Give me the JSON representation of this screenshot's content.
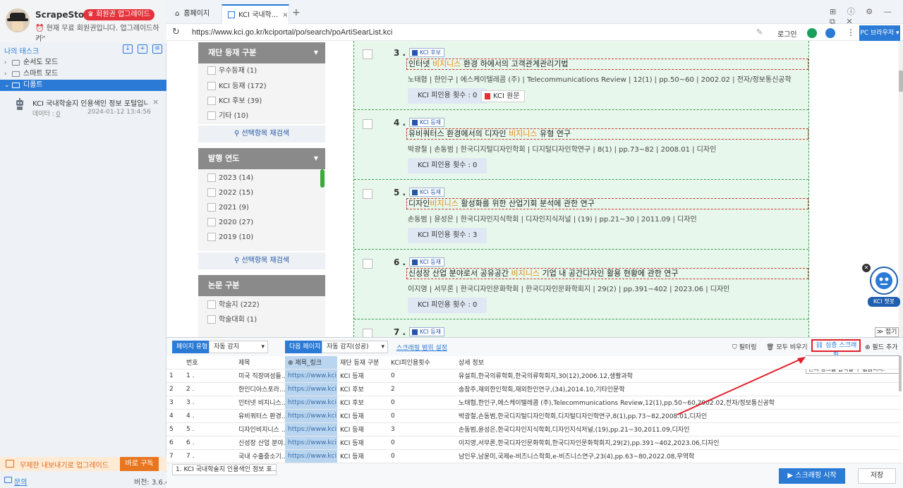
{
  "sidebar": {
    "app_name": "ScrapeStorm",
    "upgrade_badge": "회원권 업그레이드",
    "member_text": "현재 무료 회원권입니다. 업그레이드하기",
    "member_more": ">>",
    "my_tasks": "나의 태스크",
    "tree": [
      "순서도 모드",
      "스마트 모드",
      "디폴트"
    ],
    "task": {
      "title": "KCI 국내학술지 인용색인 정보 포털입니다.-...",
      "data_label": "데이터 :",
      "data_count": "0",
      "date": "2024-01-12 13:4:56"
    },
    "promo_text": "무제한 내보내기로 업그레이드",
    "promo_btn": "바로 구독",
    "inquiry": "문의",
    "version": "버전: 3.6.4"
  },
  "browser": {
    "tabs": [
      "홈페이지",
      "KCI 국내학..."
    ],
    "url": "https://www.kci.go.kr/kciportal/po/search/poArtiSearList.kci",
    "login": "로그인",
    "pc_browser": "PC 브라우저"
  },
  "facets": {
    "registration": {
      "title": "재단 등재 구분",
      "items": [
        {
          "label": "우수등재",
          "count": "(1)"
        },
        {
          "label": "KCI 등재",
          "count": "(172)"
        },
        {
          "label": "KCI 후보",
          "count": "(39)"
        },
        {
          "label": "기타",
          "count": "(10)"
        }
      ]
    },
    "year": {
      "title": "발행 연도",
      "items": [
        {
          "label": "2023",
          "count": "(14)"
        },
        {
          "label": "2022",
          "count": "(15)"
        },
        {
          "label": "2021",
          "count": "(9)"
        },
        {
          "label": "2020",
          "count": "(27)"
        },
        {
          "label": "2019",
          "count": "(10)"
        }
      ]
    },
    "paper_type": {
      "title": "논문 구분",
      "items": [
        {
          "label": "학술지",
          "count": "(222)"
        },
        {
          "label": "학술대회",
          "count": "(1)"
        }
      ]
    },
    "research_btn": "선택항목 재검색"
  },
  "results": [
    {
      "num": "3 .",
      "badge": "KCI 후보",
      "title_pre": "인터넷 ",
      "title_hl": "비지니스",
      "title_post": " 환경 하에서의 고객관계관리기법",
      "meta": "노태협 | 한인구 | 에스케이텔레콤 (주) | Telecommunications Review | 12(1) | pp.50~60 | 2002.02 | 전자/정보통신공학",
      "cite": "KCI 피인용 횟수 : 0",
      "orig": "KCI 원문"
    },
    {
      "num": "4 .",
      "badge": "KCI 등재",
      "title_pre": "유비쿼터스 환경에서의 디자인 ",
      "title_hl": "비지니스",
      "title_post": " 유형 연구",
      "meta": "박광철 | 손동범 | 한국디지털디자인학회 | 디지털디자인학연구 | 8(1) | pp.73~82 | 2008.01 | 디자인",
      "cite": "KCI 피인용 횟수 : 0",
      "orig": ""
    },
    {
      "num": "5 .",
      "badge": "KCI 등재",
      "title_pre": "디자인",
      "title_hl": "비지니스",
      "title_post": " 활성화를 위한 산업기회 분석에 관한 연구",
      "meta": "손동범 | 윤성은 | 한국디자인지식학회 | 디자인지식저널 | (19) | pp.21~30 | 2011.09 | 디자인",
      "cite": "KCI 피인용 횟수 : 3",
      "orig": ""
    },
    {
      "num": "6 .",
      "badge": "KCI 등재",
      "title_pre": "신성장 산업 분야로서 공유공간 ",
      "title_hl": "비지니스",
      "title_post": " 기업 내 공간디자인 활용 현황에 관한 연구",
      "meta": "이지영 | 서무론 | 한국디자인문화학회 | 한국디자인문화학회지 | 29(2) | pp.391~402 | 2023.06 | 디자인",
      "cite": "KCI 피인용 횟수 : 0",
      "orig": ""
    },
    {
      "num": "7 .",
      "badge": "KCI 등재",
      "title_pre": "",
      "title_hl": "",
      "title_post": "",
      "meta": "",
      "cite": "",
      "orig": ""
    }
  ],
  "chatbot_label": "KCI 챗봇",
  "collapse": "≫ 접기",
  "panel": {
    "page_type_label": "페이지 유형",
    "page_type_value": "자동 감지",
    "next_page_label": "다음 페이지",
    "next_page_value": "자동 감지(성공)",
    "scrape_range": "스크래핑 범위 설정",
    "filter": "필터링",
    "clear_all": "모두 비우기",
    "deep_scrape": "심층 스크래핑",
    "add_field": "필드 추가",
    "tooltip": "디폴트로 첫 번째 링크를 엽니다. 표 안의 링크를 클릭할 수 없습니다.",
    "columns": [
      "",
      "번호",
      "제목",
      "제목_링크",
      "재단 등재 구분",
      "KCI피인용횟수",
      "상세 정보"
    ],
    "rows": [
      [
        "1",
        "1 .",
        "미국 직장여성들...",
        "https://www.kci....",
        "KCI 등재",
        "0",
        "유설희,한국의류학회,한국의류학회지,30(12),2006.12,생활과학"
      ],
      [
        "2",
        "2 .",
        "한인디아스포라...",
        "https://www.kci....",
        "KCI 후보",
        "2",
        "송창주,재외한인학회,재외한인연구,(34),2014.10,기타인문학"
      ],
      [
        "3",
        "3 .",
        "인터넷 비지니스...",
        "https://www.kci....",
        "KCI 후보",
        "0",
        "노태협,한인구,에스케이텔레콤 (주),Telecommunications Review,12(1),pp.50~60,2002.02,전자/정보통신공학"
      ],
      [
        "4",
        "4 .",
        "유비쿼터스 환경...",
        "https://www.kci....",
        "KCI 등재",
        "0",
        "박광철,손동범,한국디지털디자인학회,디지털디자인학연구,8(1),pp.73~82,2008.01,디자인"
      ],
      [
        "5",
        "5 .",
        "디자인비지니스 ...",
        "https://www.kci....",
        "KCI 등재",
        "3",
        "손동범,윤성은,한국디자인지식학회,디자인지식저널,(19),pp.21~30,2011.09,디자인"
      ],
      [
        "6",
        "6 .",
        "신성장 산업 분야...",
        "https://www.kci....",
        "KCI 등재",
        "0",
        "이지영,서무론,한국디자인문화학회,한국디자인문화학회지,29(2),pp.391~402,2023.06,디자인"
      ],
      [
        "7",
        "7 .",
        "국내 수출중소기...",
        "https://www.kci....",
        "KCI 등재",
        "0",
        "남인우,남윤미,국제e-비즈니스학회,e-비즈니스연구,23(4),pp.63~80,2022.08,무역학"
      ]
    ]
  },
  "bottom": {
    "task_tab": "1. KCI 국내학술지 인용색인 정보 표...",
    "start_btn": "▶ 스크래핑 시작",
    "save_btn": "저장"
  }
}
